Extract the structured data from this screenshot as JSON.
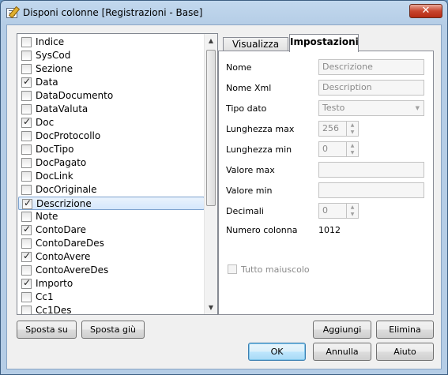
{
  "window": {
    "title": "Disponi colonne [Registrazioni - Base]",
    "close_label": "✕"
  },
  "columns": [
    {
      "label": "Indice",
      "checked": false
    },
    {
      "label": "SysCod",
      "checked": false
    },
    {
      "label": "Sezione",
      "checked": false
    },
    {
      "label": "Data",
      "checked": true
    },
    {
      "label": "DataDocumento",
      "checked": false
    },
    {
      "label": "DataValuta",
      "checked": false
    },
    {
      "label": "Doc",
      "checked": true
    },
    {
      "label": "DocProtocollo",
      "checked": false
    },
    {
      "label": "DocTipo",
      "checked": false
    },
    {
      "label": "DocPagato",
      "checked": false
    },
    {
      "label": "DocLink",
      "checked": false
    },
    {
      "label": "DocOriginale",
      "checked": false
    },
    {
      "label": "Descrizione",
      "checked": true,
      "selected": true
    },
    {
      "label": "Note",
      "checked": false
    },
    {
      "label": "ContoDare",
      "checked": true
    },
    {
      "label": "ContoDareDes",
      "checked": false
    },
    {
      "label": "ContoAvere",
      "checked": true
    },
    {
      "label": "ContoAvereDes",
      "checked": false
    },
    {
      "label": "Importo",
      "checked": true
    },
    {
      "label": "Cc1",
      "checked": false
    },
    {
      "label": "Cc1Des",
      "checked": false
    }
  ],
  "tabs": [
    {
      "label": "Visualizza",
      "active": false
    },
    {
      "label": "Impostazioni",
      "active": true
    }
  ],
  "settings": {
    "nome_label": "Nome",
    "nome_value": "Descrizione",
    "nome_xml_label": "Nome Xml",
    "nome_xml_value": "Description",
    "tipo_dato_label": "Tipo dato",
    "tipo_dato_value": "Testo",
    "lunghezza_max_label": "Lunghezza max",
    "lunghezza_max_value": "256",
    "lunghezza_min_label": "Lunghezza min",
    "lunghezza_min_value": "0",
    "valore_max_label": "Valore max",
    "valore_max_value": "",
    "valore_min_label": "Valore min",
    "valore_min_value": "",
    "decimali_label": "Decimali",
    "decimali_value": "0",
    "numero_colonna_label": "Numero colonna",
    "numero_colonna_value": "1012",
    "tutto_maiuscolo_label": "Tutto maiuscolo"
  },
  "buttons": {
    "sposta_su": "Sposta su",
    "sposta_giu": "Sposta giù",
    "aggiungi": "Aggiungi",
    "elimina": "Elimina",
    "ok": "OK",
    "annulla": "Annulla",
    "aiuto": "Aiuto"
  }
}
